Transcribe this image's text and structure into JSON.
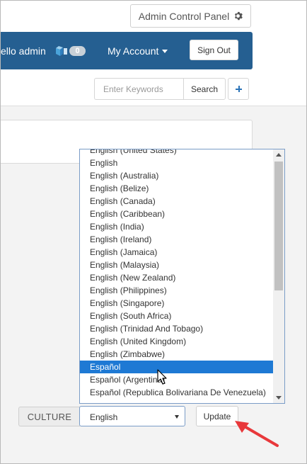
{
  "header": {
    "admin_panel_label": "Admin Control Panel",
    "greeting": "ello admin",
    "cart_count": "0",
    "account_label": "My Account",
    "sign_out_label": "Sign Out"
  },
  "search": {
    "placeholder": "Enter Keywords",
    "button_label": "Search"
  },
  "culture": {
    "label": "CULTURE",
    "selected_value": "English",
    "update_label": "Update",
    "options": [
      "English (United States)",
      "English",
      "English (Australia)",
      "English (Belize)",
      "English (Canada)",
      "English (Caribbean)",
      "English (India)",
      "English (Ireland)",
      "English (Jamaica)",
      "English (Malaysia)",
      "English (New Zealand)",
      "English (Philippines)",
      "English (Singapore)",
      "English (South Africa)",
      "English (Trinidad And Tobago)",
      "English (United Kingdom)",
      "English (Zimbabwe)",
      "Español",
      "Español (Argentina)",
      "Español (Republica Bolivariana De Venezuela)"
    ],
    "highlighted_option": "Español"
  },
  "colors": {
    "navbar": "#255f91",
    "highlight": "#1e79d4",
    "annotation_arrow": "#e8383b"
  },
  "icons": {
    "admin_panel": "gear-icon",
    "cart": "cart-icon",
    "add": "plus-icon",
    "cursor": "mouse-pointer-icon"
  }
}
